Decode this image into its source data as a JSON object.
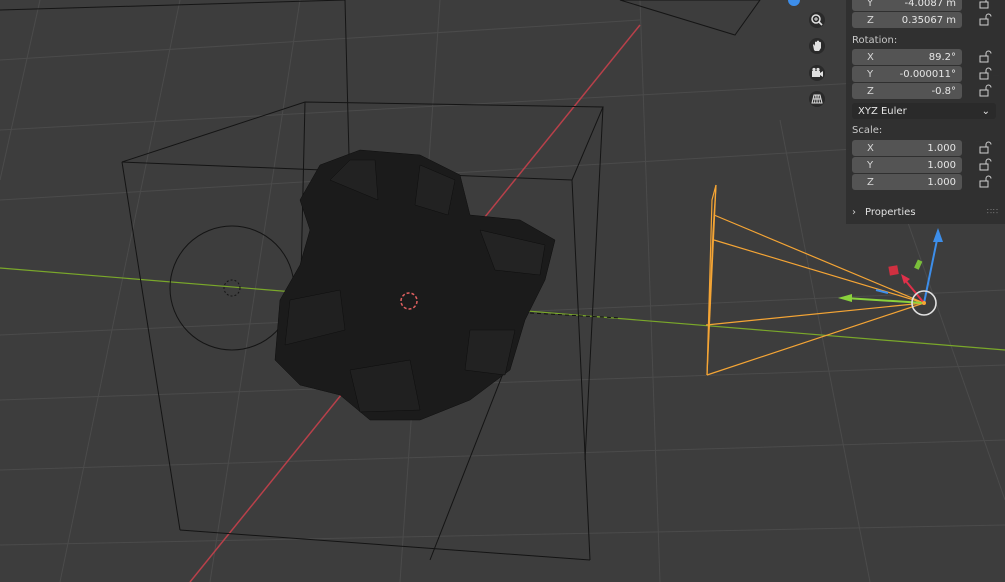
{
  "navigation_gizmo": {
    "zoom_icon": "zoom-icon",
    "pan_icon": "hand-icon",
    "camera_icon": "camera-icon",
    "perspective_icon": "grid-icon"
  },
  "transform_panel": {
    "location": {
      "y": {
        "axis": "Y",
        "value": "-4.0087 m"
      },
      "z": {
        "axis": "Z",
        "value": "0.35067 m"
      }
    },
    "rotation_label": "Rotation:",
    "rotation": [
      {
        "axis": "X",
        "value": "89.2°"
      },
      {
        "axis": "Y",
        "value": "-0.000011°"
      },
      {
        "axis": "Z",
        "value": "-0.8°"
      }
    ],
    "rotation_mode": "XYZ Euler",
    "scale_label": "Scale:",
    "scale": [
      {
        "axis": "X",
        "value": "1.000"
      },
      {
        "axis": "Y",
        "value": "1.000"
      },
      {
        "axis": "Z",
        "value": "1.000"
      }
    ],
    "properties_label": "Properties"
  },
  "colors": {
    "viewport_bg": "#3d3d3d",
    "grid": "#4a4a4a",
    "x_axis": "#c0404a",
    "y_axis": "#7aa82a",
    "camera": "#f5a535",
    "gizmo_blue": "#3d8eea",
    "gizmo_red": "#e0304a",
    "gizmo_green": "#8ad23c"
  }
}
